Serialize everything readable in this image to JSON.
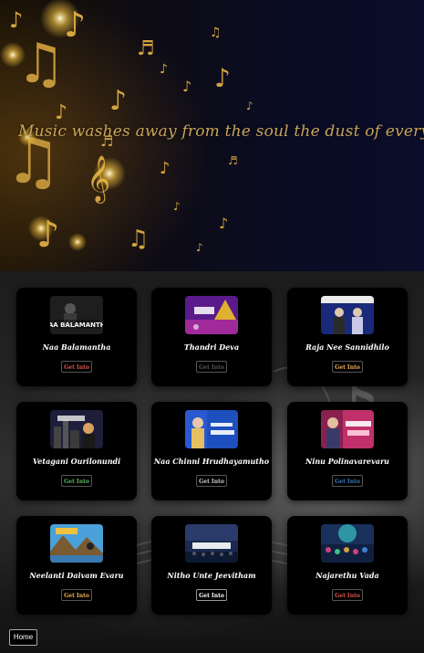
{
  "hero": {
    "quote": "Music washes away from the soul the dust of everyday life"
  },
  "songs": [
    {
      "title": "Naa Balamantha",
      "button": "Get Into",
      "button_color": "#d9534f",
      "thumb_text": "NAA BALAMANTHA",
      "thumb_icon": "singer-portrait"
    },
    {
      "title": "Thandri Deva",
      "button": "Get Into",
      "button_color": "#555555",
      "thumb_text": "",
      "thumb_icon": "purple-album-art"
    },
    {
      "title": "Raja Nee Sannidhilo",
      "button": "Get Into",
      "button_color": "#f0ad4e",
      "thumb_text": "",
      "thumb_icon": "duet-album-art"
    },
    {
      "title": "Vetagani Ourilonundi",
      "button": "Get Into",
      "button_color": "#5cb85c",
      "thumb_text": "",
      "thumb_icon": "city-album-art"
    },
    {
      "title": "Naa Chinni Hrudhayamutho",
      "button": "Get Into",
      "button_color": "#cccccc",
      "thumb_text": "",
      "thumb_icon": "singer-album-art"
    },
    {
      "title": "Ninu Polinavarevaru",
      "button": "Get Into",
      "button_color": "#337ab7",
      "thumb_text": "",
      "thumb_icon": "pink-album-art"
    },
    {
      "title": "Neelanti Daivam Evaru",
      "button": "Get Into",
      "button_color": "#f0ad4e",
      "thumb_text": "",
      "thumb_icon": "mountain-album-art"
    },
    {
      "title": "Nitho Unte Jeevitham",
      "button": "Get Into",
      "button_color": "#ffffff",
      "thumb_text": "",
      "thumb_icon": "crowd-album-art"
    },
    {
      "title": "Najarethu Vada",
      "button": "Get Into",
      "button_color": "#d9534f",
      "thumb_text": "",
      "thumb_icon": "concert-album-art"
    }
  ],
  "footer": {
    "home_label": "Home"
  },
  "colors": {
    "quote_gold": "#c8a45a",
    "card_bg": "#000000"
  }
}
